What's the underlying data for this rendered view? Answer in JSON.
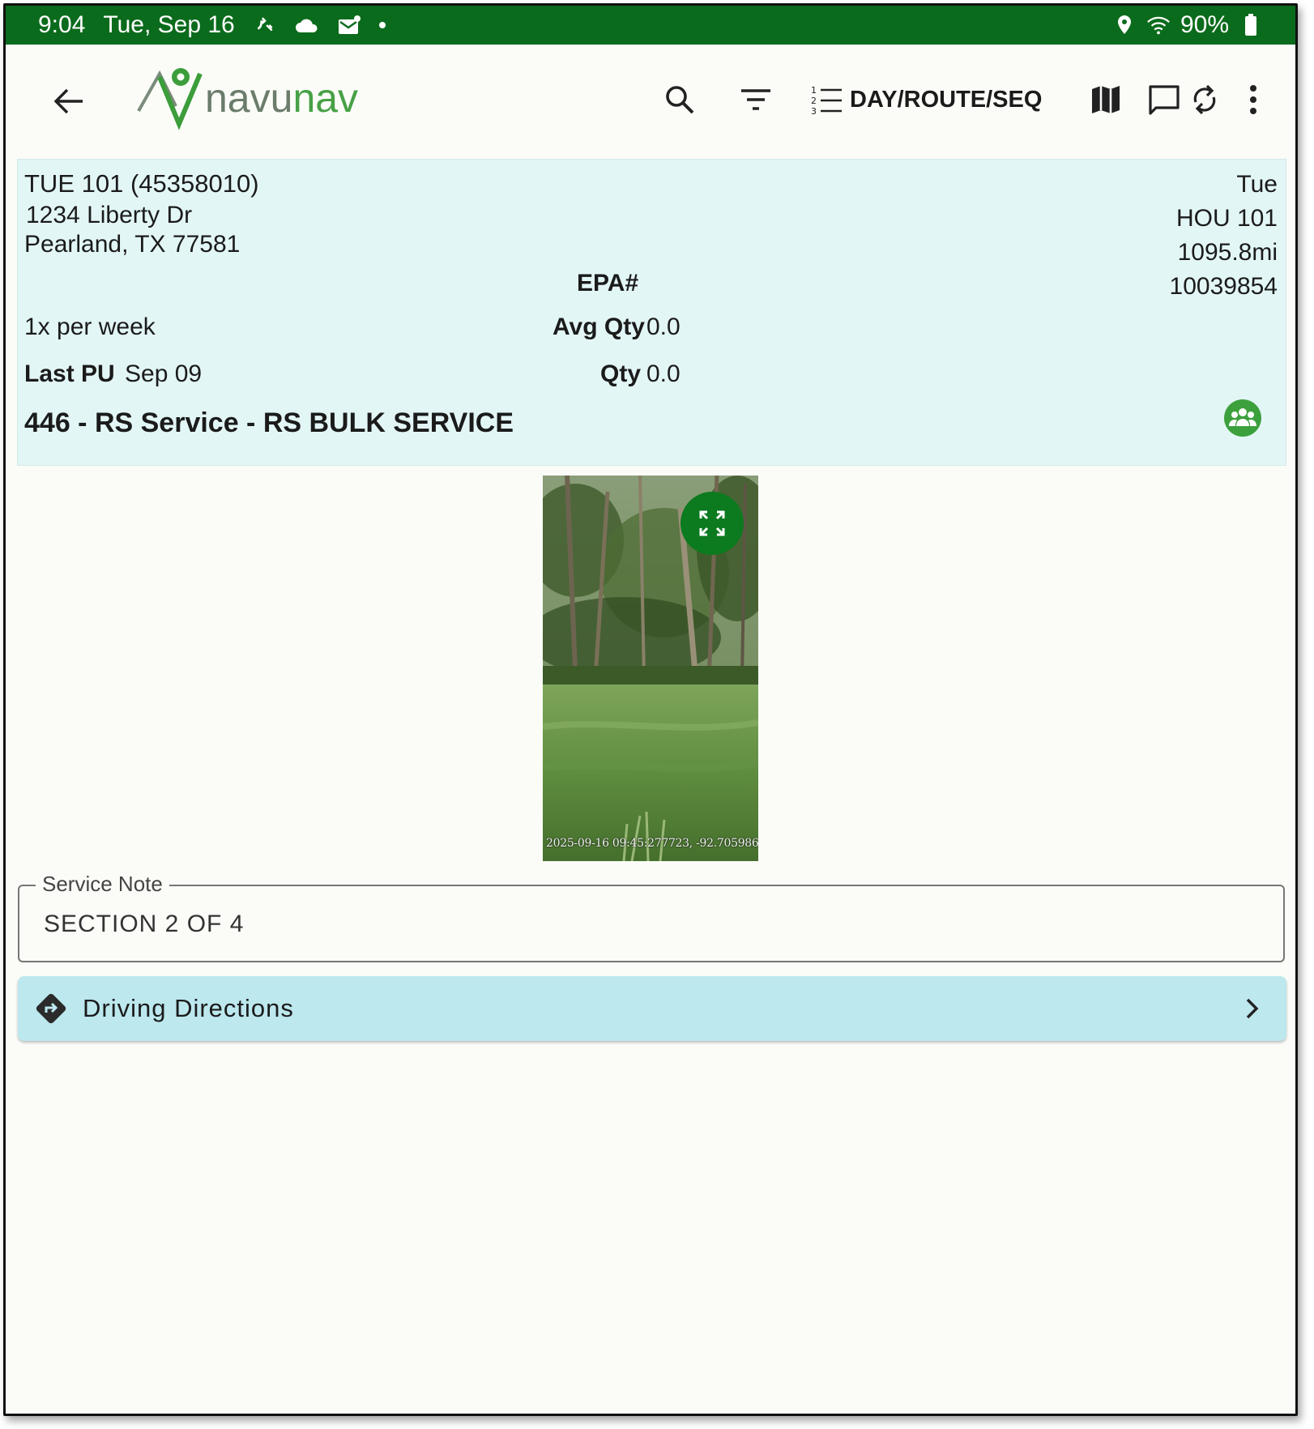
{
  "status_bar": {
    "time": "9:04",
    "date": "Tue, Sep 16",
    "battery": "90%",
    "icons": [
      "call-forward-icon",
      "cloud-icon",
      "mail-icon",
      "dot-icon",
      "location-icon",
      "wifi-icon",
      "battery-icon"
    ]
  },
  "app_bar": {
    "logo_text_main": "navu",
    "logo_text_accent": "nav",
    "sort_label": "DAY/ROUTE/SEQ",
    "icons": [
      "back-arrow-icon",
      "search-icon",
      "filter-icon",
      "numbered-list-icon",
      "map-icon",
      "chat-icon",
      "sync-icon",
      "more-vert-icon"
    ]
  },
  "stop": {
    "title": "TUE 101 (45358010)",
    "address_line1": "1234 Liberty Dr",
    "address_line2": "Pearland, TX 77581",
    "epa_label": "EPA#",
    "frequency": "1x per week",
    "avg_qty_label": "Avg Qty",
    "avg_qty_value": "0.0",
    "last_pu_label": "Last PU",
    "last_pu_value": "Sep 09",
    "qty_label": "Qty",
    "qty_value": "0.0",
    "service": "446 - RS Service - RS BULK SERVICE",
    "day": "Tue",
    "route": "HOU 101",
    "distance": "1095.8mi",
    "account_number": "10039854"
  },
  "photo": {
    "stamp": "2025-09-16 09:45:277723, -92.705986"
  },
  "service_note": {
    "label": "Service Note",
    "value": "SECTION 2 OF 4"
  },
  "directions": {
    "label": "Driving Directions"
  },
  "colors": {
    "status_bar": "#0b6b1c",
    "card_bg": "#e3f6f6",
    "directions_bg": "#bce8ee",
    "accent_green": "#0c7a1f"
  }
}
